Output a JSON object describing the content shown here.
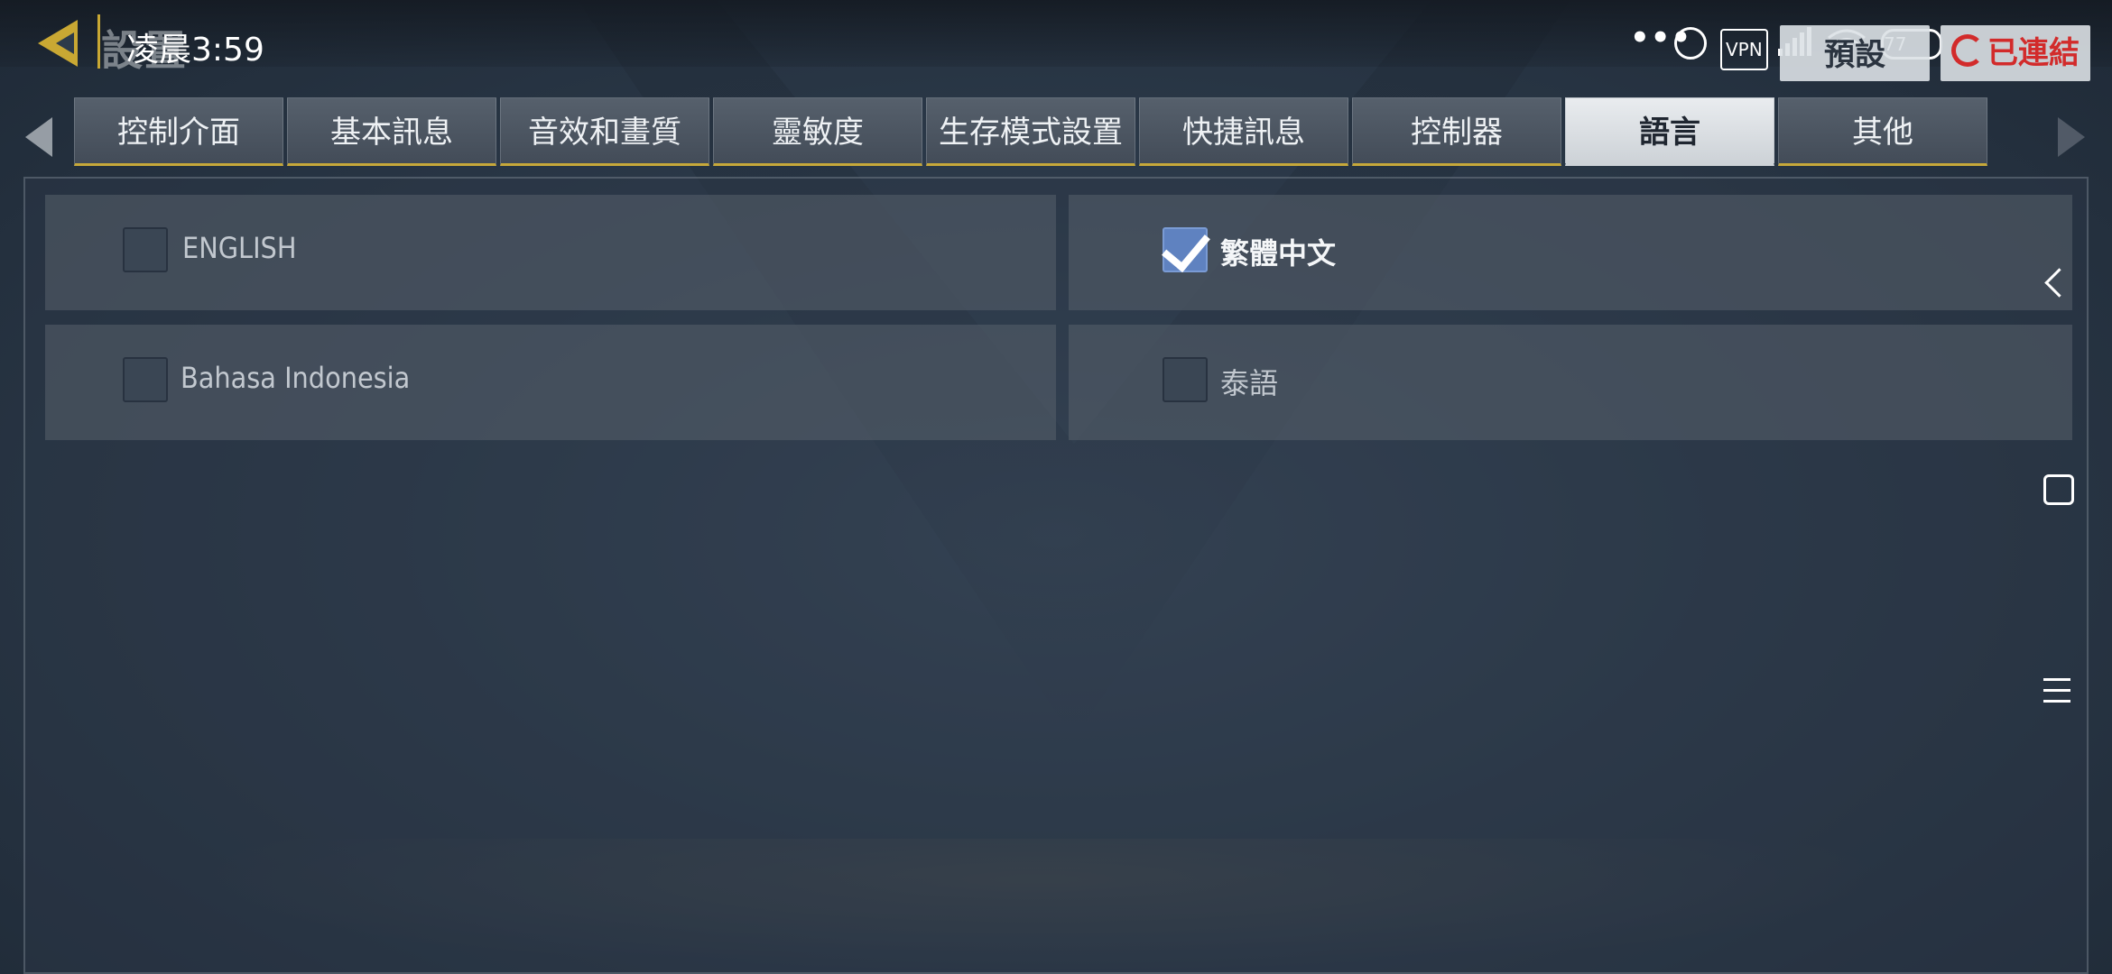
{
  "status_bar": {
    "time": "凌晨3:59",
    "dots": "•••",
    "vpn": "VPN",
    "battery": "77"
  },
  "header": {
    "title": "設置",
    "preset_label": "預設",
    "connected_label": "已連結"
  },
  "tabs": [
    {
      "label": "控制介面",
      "active": false
    },
    {
      "label": "基本訊息",
      "active": false
    },
    {
      "label": "音效和畫質",
      "active": false
    },
    {
      "label": "靈敏度",
      "active": false
    },
    {
      "label": "生存模式設置",
      "active": false
    },
    {
      "label": "快捷訊息",
      "active": false
    },
    {
      "label": "控制器",
      "active": false
    },
    {
      "label": "語言",
      "active": true
    },
    {
      "label": "其他",
      "active": false
    }
  ],
  "languages": [
    {
      "label": "ENGLISH",
      "checked": false
    },
    {
      "label": "繁體中文",
      "checked": true
    },
    {
      "label": "Bahasa Indonesia",
      "checked": false
    },
    {
      "label": "泰語",
      "checked": false
    }
  ],
  "colors": {
    "accent_gold": "#c6a83a",
    "checkbox_checked": "#5f82c0",
    "connected_red": "#d22b2b"
  }
}
